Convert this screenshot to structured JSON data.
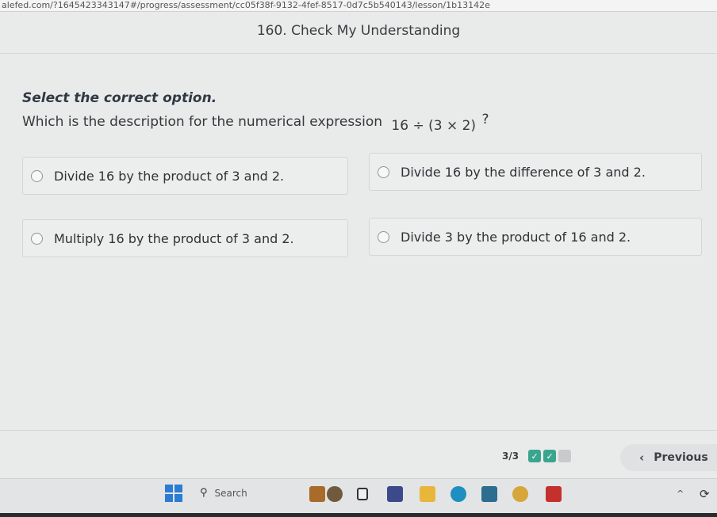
{
  "browser": {
    "url": "alefed.com/?1645423343147#/progress/assessment/cc05f38f-9132-4fef-8517-0d7c5b540143/lesson/1b13142e"
  },
  "header": {
    "title": "160. Check My Understanding"
  },
  "question": {
    "instruction": "Select the correct option.",
    "prompt": "Which is the description for the numerical expression",
    "expression": "16 ÷ (3 × 2)",
    "question_mark": "?"
  },
  "options": [
    {
      "label": "Divide 16 by the product of 3 and 2."
    },
    {
      "label": "Divide 16 by the difference of 3 and 2."
    },
    {
      "label": "Multiply 16 by the product of 3 and 2."
    },
    {
      "label": "Divide 3 by the product of 16 and 2."
    }
  ],
  "footer": {
    "progress_text": "3/3",
    "check_glyph": "✓",
    "steps": [
      "complete",
      "complete",
      "incomplete"
    ],
    "previous_label": "Previous",
    "previous_chevron": "‹"
  },
  "taskbar": {
    "search_label": "Search",
    "search_icon": "⚲",
    "chevron_up": "^",
    "tray_icon": "⟳"
  },
  "colors": {
    "accent_check": "#3aa58e",
    "windows_blue": "#2b7cd3"
  }
}
